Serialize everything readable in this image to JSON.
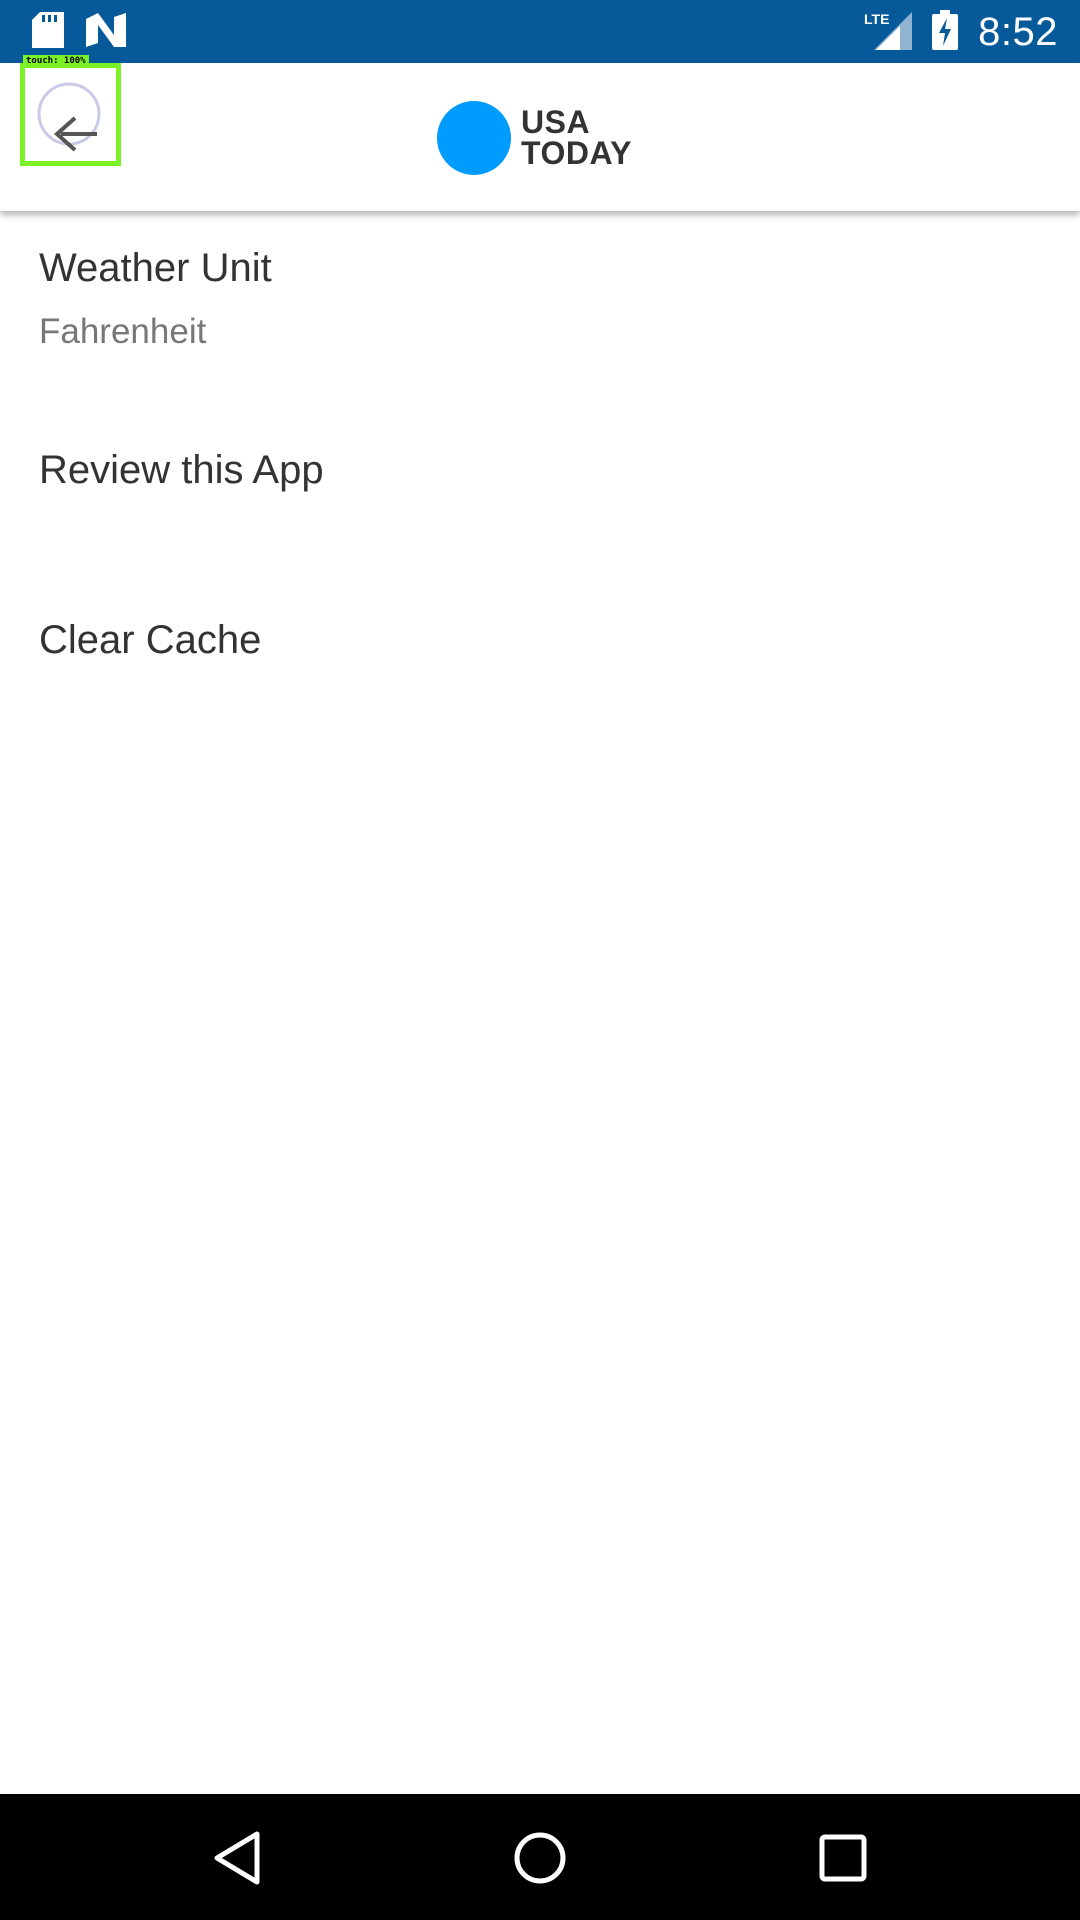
{
  "status_bar": {
    "time": "8:52",
    "network": "LTE",
    "icons": [
      "sd-card-icon",
      "n-notification-icon",
      "lte-signal-icon",
      "battery-charging-icon"
    ]
  },
  "app_bar": {
    "touch_label": "touch: 100%",
    "logo_line1": "USA",
    "logo_line2": "TODAY",
    "accent_color": "#009bff"
  },
  "settings": {
    "weather_unit": {
      "title": "Weather Unit",
      "value": "Fahrenheit"
    },
    "review": {
      "title": "Review this App"
    },
    "clear_cache": {
      "title": "Clear Cache"
    }
  },
  "nav_bar": {
    "icons": [
      "back-nav-icon",
      "home-nav-icon",
      "recents-nav-icon"
    ]
  }
}
